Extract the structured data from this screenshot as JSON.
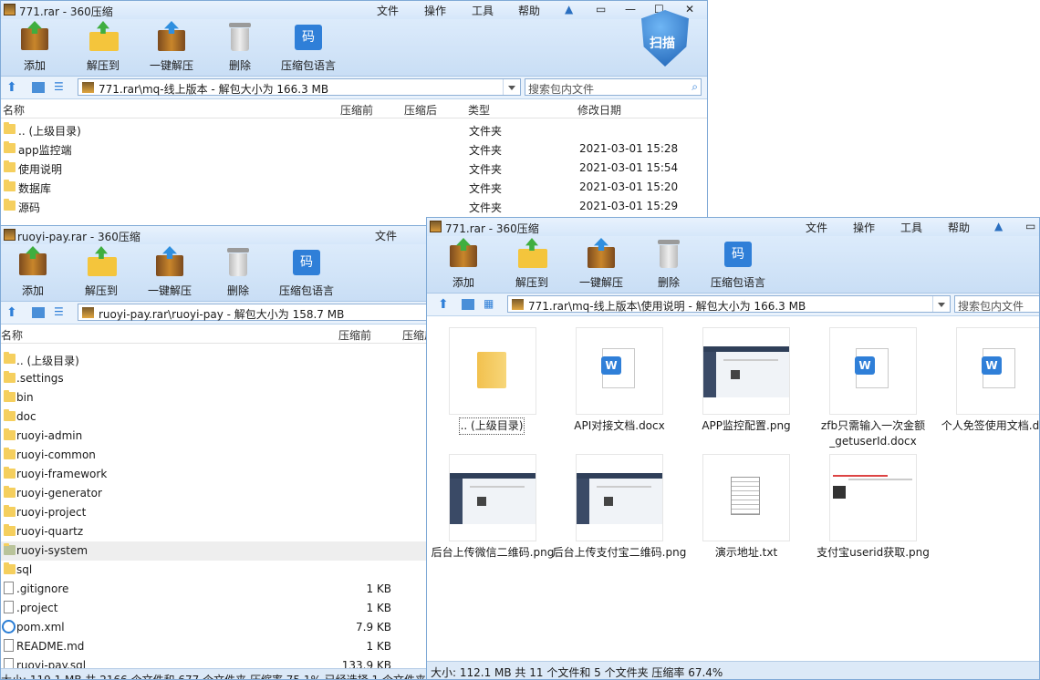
{
  "win1": {
    "title": "771.rar - 360压缩",
    "menu": [
      "文件",
      "操作",
      "工具",
      "帮助"
    ],
    "toolbar": [
      "添加",
      "解压到",
      "一键解压",
      "删除",
      "压缩包语言"
    ],
    "scan_label": "扫描",
    "path": "771.rar\\mq-线上版本 - 解包大小为 166.3 MB",
    "search_placeholder": "搜索包内文件",
    "columns": [
      "名称",
      "压缩前",
      "压缩后",
      "类型",
      "修改日期"
    ],
    "rows": [
      {
        "name": ".. (上级目录)",
        "type": "文件夹",
        "date": ""
      },
      {
        "name": "app监控端",
        "type": "文件夹",
        "date": "2021-03-01 15:28"
      },
      {
        "name": "使用说明",
        "type": "文件夹",
        "date": "2021-03-01 15:54"
      },
      {
        "name": "数据库",
        "type": "文件夹",
        "date": "2021-03-01 15:20"
      },
      {
        "name": "源码",
        "type": "文件夹",
        "date": "2021-03-01 15:29"
      }
    ]
  },
  "win2": {
    "title": "ruoyi-pay.rar - 360压缩",
    "menu": [
      "文件"
    ],
    "toolbar": [
      "添加",
      "解压到",
      "一键解压",
      "删除",
      "压缩包语言"
    ],
    "path": "ruoyi-pay.rar\\ruoyi-pay - 解包大小为 158.7 MB",
    "columns": [
      "名称",
      "压缩前",
      "压缩后"
    ],
    "rows": [
      {
        "name": ".. (上级目录)",
        "kind": "folder",
        "size": ""
      },
      {
        "name": ".settings",
        "kind": "folder",
        "size": ""
      },
      {
        "name": "bin",
        "kind": "folder",
        "size": ""
      },
      {
        "name": "doc",
        "kind": "folder",
        "size": ""
      },
      {
        "name": "ruoyi-admin",
        "kind": "folder",
        "size": ""
      },
      {
        "name": "ruoyi-common",
        "kind": "folder",
        "size": ""
      },
      {
        "name": "ruoyi-framework",
        "kind": "folder",
        "size": ""
      },
      {
        "name": "ruoyi-generator",
        "kind": "folder",
        "size": ""
      },
      {
        "name": "ruoyi-project",
        "kind": "folder",
        "size": ""
      },
      {
        "name": "ruoyi-quartz",
        "kind": "folder",
        "size": ""
      },
      {
        "name": "ruoyi-system",
        "kind": "folder",
        "size": "",
        "selected": true
      },
      {
        "name": "sql",
        "kind": "folder",
        "size": ""
      },
      {
        "name": ".gitignore",
        "kind": "file",
        "size": "1 KB"
      },
      {
        "name": ".project",
        "kind": "file",
        "size": "1 KB"
      },
      {
        "name": "pom.xml",
        "kind": "ie",
        "size": "7.9 KB"
      },
      {
        "name": "README.md",
        "kind": "file",
        "size": "1 KB"
      },
      {
        "name": "ruoyi-pay.sql",
        "kind": "file",
        "size": "133.9 KB"
      }
    ],
    "status": "大小: 119.1 MB 共 2166 个文件和 677 个文件夹 压缩率 75.1% 已经选择 1 个文件夹"
  },
  "win3": {
    "title": "771.rar - 360压缩",
    "menu": [
      "文件",
      "操作",
      "工具",
      "帮助"
    ],
    "toolbar": [
      "添加",
      "解压到",
      "一键解压",
      "删除",
      "压缩包语言"
    ],
    "path": "771.rar\\mq-线上版本\\使用说明 - 解包大小为 166.3 MB",
    "search_placeholder": "搜索包内文件",
    "items": [
      {
        "label": ".. (上级目录)",
        "kind": "folder"
      },
      {
        "label": "API对接文档.docx",
        "kind": "word"
      },
      {
        "label": "APP监控配置.png",
        "kind": "image"
      },
      {
        "label": "zfb只需输入一次金额_getuserId.docx",
        "kind": "word"
      },
      {
        "label": "个人免签使用文档.docx",
        "kind": "word"
      },
      {
        "label": "后台上传微信二维码.png",
        "kind": "image"
      },
      {
        "label": "后台上传支付宝二维码.png",
        "kind": "image"
      },
      {
        "label": "演示地址.txt",
        "kind": "txt"
      },
      {
        "label": "支付宝userid获取.png",
        "kind": "image2"
      }
    ],
    "status": "大小: 112.1 MB 共 11 个文件和 5 个文件夹 压缩率 67.4%"
  }
}
